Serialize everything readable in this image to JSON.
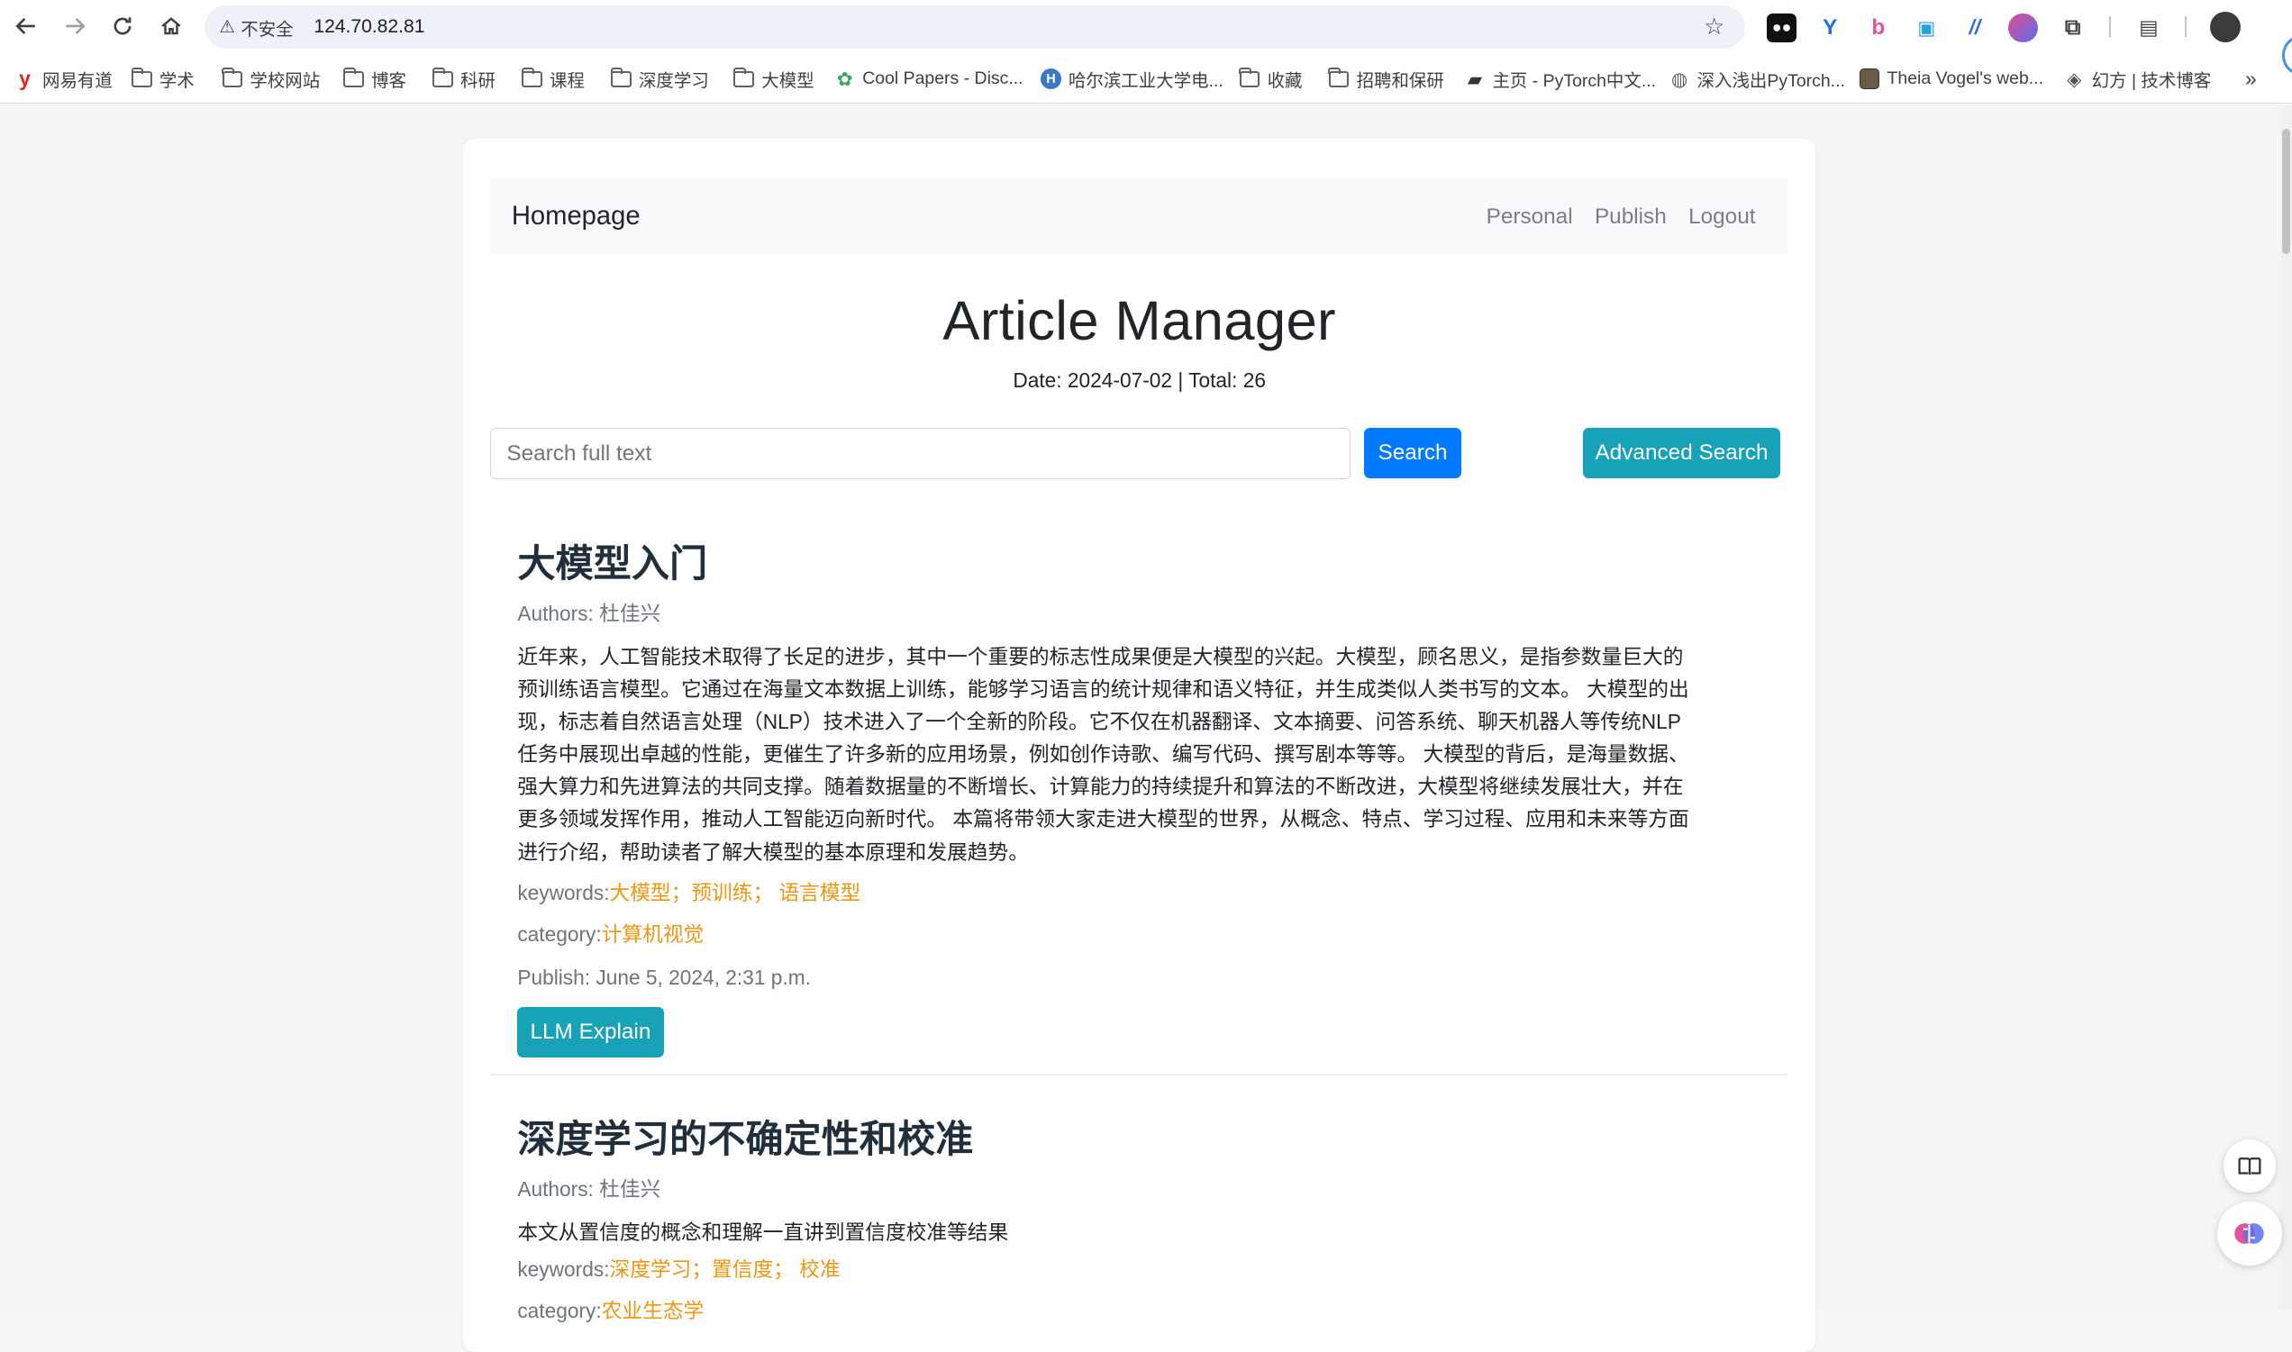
{
  "browser": {
    "security_label": "不安全",
    "url": "124.70.82.81"
  },
  "bookmarks": [
    {
      "label": "网易有道",
      "icon": "youdao-icon"
    },
    {
      "label": "学术",
      "icon": "folder-icon"
    },
    {
      "label": "学校网站",
      "icon": "folder-icon"
    },
    {
      "label": "博客",
      "icon": "folder-icon"
    },
    {
      "label": "科研",
      "icon": "folder-icon"
    },
    {
      "label": "课程",
      "icon": "folder-icon"
    },
    {
      "label": "深度学习",
      "icon": "folder-icon"
    },
    {
      "label": "大模型",
      "icon": "folder-icon"
    },
    {
      "label": "Cool Papers - Disc...",
      "icon": "coolpapers-icon"
    },
    {
      "label": "哈尔滨工业大学电...",
      "icon": "hit-icon"
    },
    {
      "label": "收藏",
      "icon": "folder-icon"
    },
    {
      "label": "招聘和保研",
      "icon": "folder-icon"
    },
    {
      "label": "主页 - PyTorch中文...",
      "icon": "book-icon"
    },
    {
      "label": "深入浅出PyTorch...",
      "icon": "globe-icon"
    },
    {
      "label": "Theia Vogel's web...",
      "icon": "theia-icon"
    },
    {
      "label": "幻方 | 技术博客",
      "icon": "huanfang-icon"
    }
  ],
  "nav": {
    "brand": "Homepage",
    "links": [
      "Personal",
      "Publish",
      "Logout"
    ]
  },
  "header": {
    "title": "Article Manager",
    "subline": "Date: 2024-07-02 | Total: 26"
  },
  "search": {
    "placeholder": "Search full text",
    "button": "Search",
    "advanced_button": "Advanced Search"
  },
  "articles": [
    {
      "title": "大模型入门",
      "authors_label": "Authors: 杜佳兴",
      "body_lines": [
        "近年来，人工智能技术取得了长足的进步，其中一个重要的标志性成果便是大模型的兴起。大模型，顾名思义，是指参数量巨大的",
        "预训练语言模型。它通过在海量文本数据上训练，能够学习语言的统计规律和语义特征，并生成类似人类书写的文本。 大模型的出",
        "现，标志着自然语言处理（NLP）技术进入了一个全新的阶段。它不仅在机器翻译、文本摘要、问答系统、聊天机器人等传统NLP",
        "任务中展现出卓越的性能，更催生了许多新的应用场景，例如创作诗歌、编写代码、撰写剧本等等。 大模型的背后，是海量数据、",
        "强大算力和先进算法的共同支撑。随着数据量的不断增长、计算能力的持续提升和算法的不断改进，大模型将继续发展壮大，并在",
        "更多领域发挥作用，推动人工智能迈向新时代。 本篇将带领大家走进大模型的世界，从概念、特点、学习过程、应用和未来等方面",
        "进行介绍，帮助读者了解大模型的基本原理和发展趋势。"
      ],
      "keywords_label": "keywords:",
      "keywords": "大模型；预训练； 语言模型",
      "category_label": "category:",
      "category": "计算机视觉",
      "publish": "Publish: June 5, 2024, 2:31 p.m.",
      "button": "LLM Explain"
    },
    {
      "title": "深度学习的不确定性和校准",
      "authors_label": "Authors: 杜佳兴",
      "body_lines": [
        "本文从置信度的概念和理解一直讲到置信度校准等结果"
      ],
      "keywords_label": "keywords:",
      "keywords": "深度学习；置信度； 校准",
      "category_label": "category:",
      "category": "农业生态学"
    }
  ]
}
